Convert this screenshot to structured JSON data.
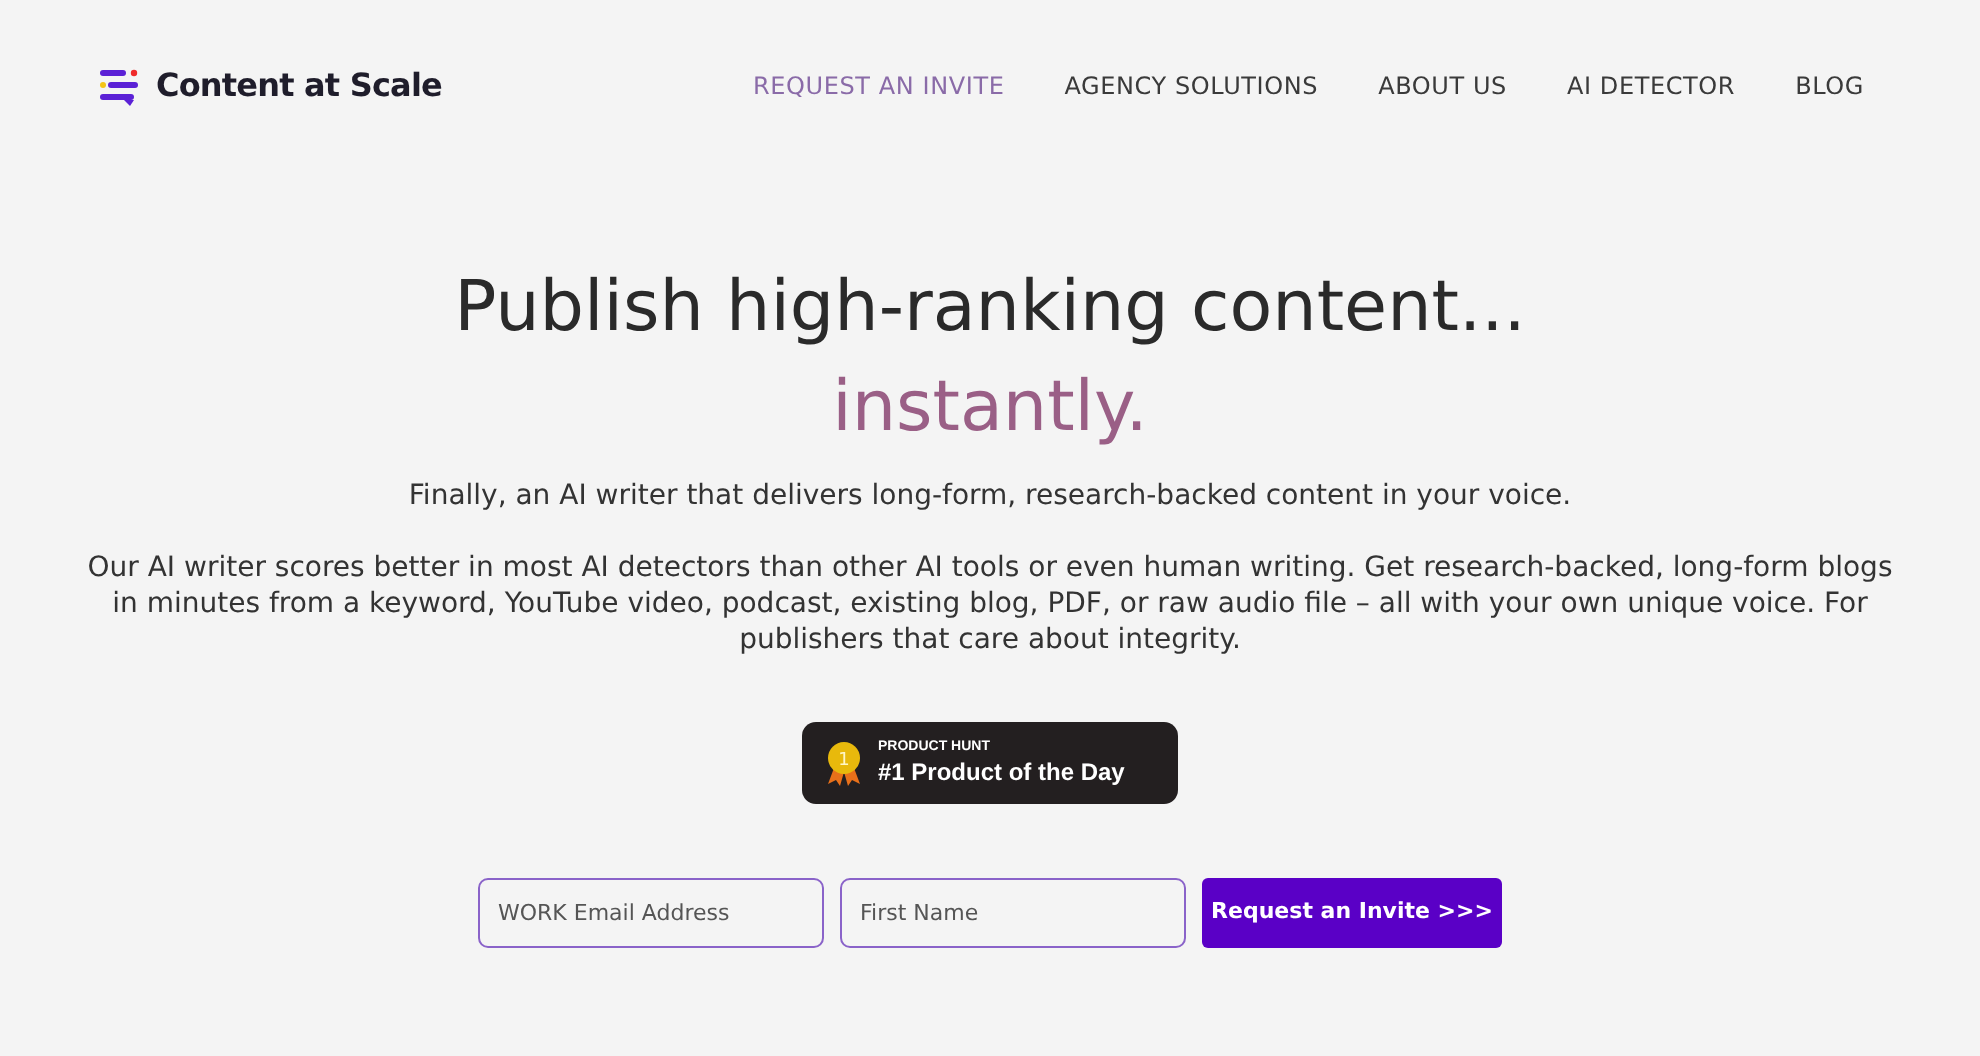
{
  "header": {
    "logo_text": "Content at Scale",
    "nav": [
      {
        "label": "REQUEST AN INVITE",
        "selected": true
      },
      {
        "label": "AGENCY SOLUTIONS",
        "selected": false
      },
      {
        "label": "ABOUT US",
        "selected": false
      },
      {
        "label": "AI DETECTOR",
        "selected": false
      },
      {
        "label": "BLOG",
        "selected": false
      }
    ]
  },
  "hero": {
    "title": "Publish high-ranking content...",
    "title_accent": "instantly.",
    "subtitle": "Finally, an AI writer that delivers long-form, research-backed content in your voice.",
    "body": "Our AI writer scores better in most AI detectors than other AI tools or even human writing. Get research-backed, long-form blogs in minutes from a keyword, YouTube video, podcast, existing blog, PDF, or raw audio file – all with your own unique voice. For publishers that care about integrity.",
    "badge": {
      "eyebrow": "PRODUCT HUNT",
      "medal": "1",
      "label": "#1 Product of the Day"
    },
    "form": {
      "fields": [
        {
          "placeholder": "WORK Email Address"
        },
        {
          "placeholder": "First Name"
        }
      ],
      "submit": "Request an Invite >>>"
    }
  }
}
